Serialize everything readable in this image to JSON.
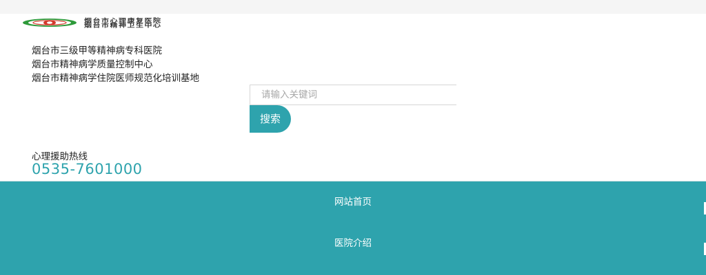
{
  "header": {
    "logo_text_line1": "烟台市心理康复医院",
    "logo_text_line2": "烟台市精神卫生中心"
  },
  "intro": {
    "lines": [
      "烟台市三级甲等精神病专科医院",
      "烟台市精神病学质量控制中心",
      "烟台市精神病学住院医师规范化培训基地"
    ]
  },
  "search": {
    "placeholder": "请输入关键词",
    "value": "",
    "button_label": "搜索"
  },
  "hotline": {
    "label": "心理援助热线",
    "number": "0535-7601000"
  },
  "nav": {
    "items": [
      {
        "label": "网站首页"
      },
      {
        "label": "医院介绍"
      }
    ]
  },
  "colors": {
    "brand_teal": "#2ea3ad",
    "logo_green": "#2e9a3a",
    "logo_red": "#d33a2c",
    "top_bar": "#f5f5f5"
  }
}
